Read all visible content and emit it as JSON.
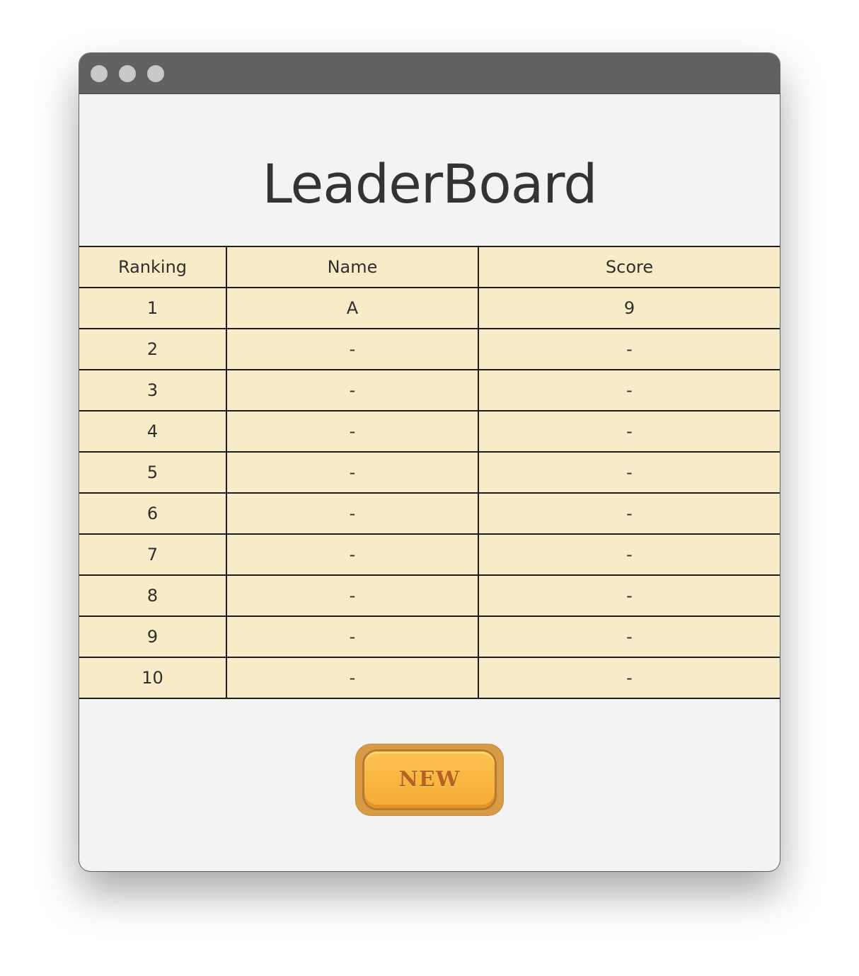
{
  "window": {
    "title_heading": "LeaderBoard"
  },
  "table": {
    "headers": [
      "Ranking",
      "Name",
      "Score"
    ],
    "rows": [
      {
        "rank": "1",
        "name": "A",
        "score": "9"
      },
      {
        "rank": "2",
        "name": "-",
        "score": "-"
      },
      {
        "rank": "3",
        "name": "-",
        "score": "-"
      },
      {
        "rank": "4",
        "name": "-",
        "score": "-"
      },
      {
        "rank": "5",
        "name": "-",
        "score": "-"
      },
      {
        "rank": "6",
        "name": "-",
        "score": "-"
      },
      {
        "rank": "7",
        "name": "-",
        "score": "-"
      },
      {
        "rank": "8",
        "name": "-",
        "score": "-"
      },
      {
        "rank": "9",
        "name": "-",
        "score": "-"
      },
      {
        "rank": "10",
        "name": "-",
        "score": "-"
      }
    ]
  },
  "actions": {
    "new_label": "NEW"
  },
  "colors": {
    "titlebar": "#616163",
    "window_bg": "#f3f3f3",
    "table_bg": "#f7ecc7",
    "button": "#f4ab35",
    "button_text": "#b8621f"
  }
}
